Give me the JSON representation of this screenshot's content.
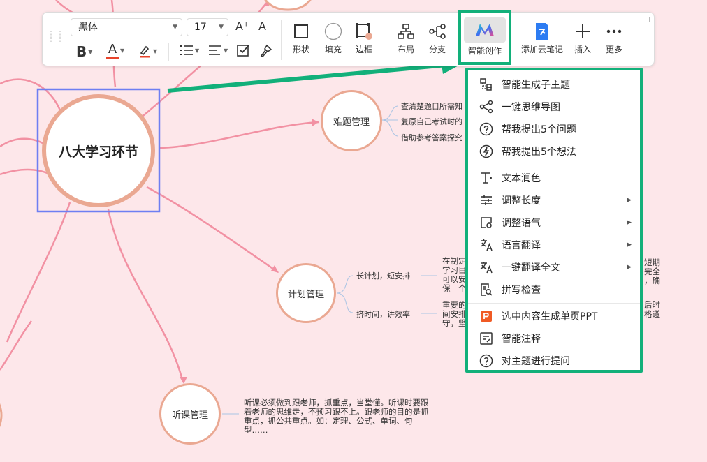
{
  "mindmap": {
    "root": "八大学习环节",
    "nodes": {
      "problem": "难题管理",
      "plan": "计划管理",
      "lecture": "听课管理"
    },
    "problem_leaves": [
      "查清楚题目所需知",
      "复原自己考试时的",
      "借助参考答案探究"
    ],
    "plan_leaves": [
      "长计划，短安排",
      "挤时间，讲效率"
    ],
    "plan_note_left_1": [
      "在制定",
      "学习目",
      "可以安",
      "保一个"
    ],
    "plan_note_right_1": [
      "短期",
      "完全",
      "，确"
    ],
    "plan_note_left_2": [
      "重要的",
      "间安排",
      "守，坚"
    ],
    "plan_note_right_2": [
      "后时",
      "格遵"
    ],
    "lecture_note": [
      "听课必须做到跟老师，抓重点，当堂懂。听课时要跟",
      "着老师的思维走，不预习跟不上。跟老师的目的是抓",
      "重点，抓公共重点。如：定理、公式、单词、句",
      "型……"
    ]
  },
  "toolbar": {
    "font_family": "黑体",
    "font_size": "17",
    "grow_font": "A⁺",
    "shrink_font": "A⁻",
    "bold": "B",
    "font_color": "A",
    "shape": "形状",
    "fill": "填充",
    "border": "边框",
    "layout": "布局",
    "branch": "分支",
    "ai_create": "智能创作",
    "cloud_note": "添加云笔记",
    "insert": "插入",
    "more": "更多",
    "accent": "#12b07a",
    "font_color_bar": "#e8442c"
  },
  "menu": {
    "items": [
      {
        "label": "智能生成子主题",
        "icon": "subtopic-icon"
      },
      {
        "label": "一键思维导图",
        "icon": "mindmap-icon"
      },
      {
        "label": "帮我提出5个问题",
        "icon": "question-icon"
      },
      {
        "label": "帮我提出5个想法",
        "icon": "lightbulb-icon"
      },
      {
        "label": "文本润色",
        "icon": "text-polish-icon"
      },
      {
        "label": "调整长度",
        "icon": "adjust-length-icon",
        "submenu": true
      },
      {
        "label": "调整语气",
        "icon": "adjust-tone-icon",
        "submenu": true
      },
      {
        "label": "语言翻译",
        "icon": "translate-icon",
        "submenu": true
      },
      {
        "label": "一键翻译全文",
        "icon": "translate-all-icon",
        "submenu": true
      },
      {
        "label": "拼写检查",
        "icon": "spellcheck-icon"
      },
      {
        "label": "选中内容生成单页PPT",
        "icon": "ppt-icon"
      },
      {
        "label": "智能注释",
        "icon": "annotation-icon"
      },
      {
        "label": "对主题进行提问",
        "icon": "ask-icon"
      }
    ]
  },
  "colors": {
    "background": "#fde7ea",
    "node_border": "#eaa892",
    "branch_line": "#f291a3",
    "selection": "#6e7ff2",
    "highlight": "#12b07a"
  }
}
